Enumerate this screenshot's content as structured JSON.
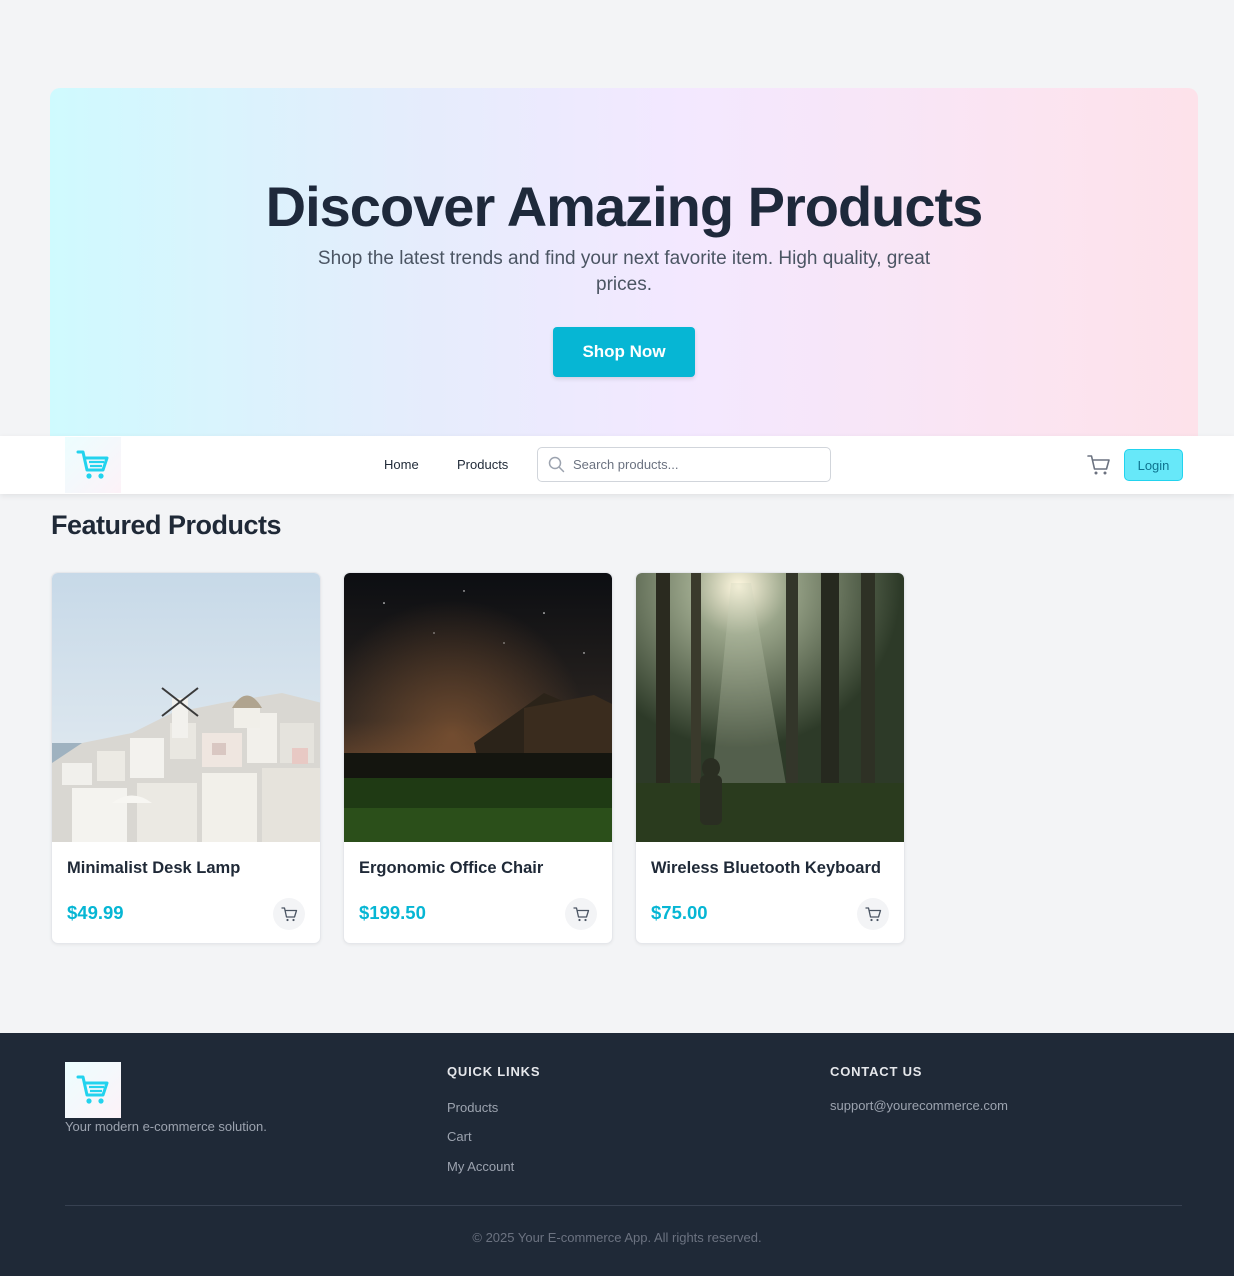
{
  "hero": {
    "title": "Discover Amazing Products",
    "subtitle": "Shop the latest trends and find your next favorite item. High quality, great prices.",
    "cta_label": "Shop Now"
  },
  "nav": {
    "home": "Home",
    "products": "Products",
    "search_placeholder": "Search products...",
    "login": "Login"
  },
  "featured": {
    "title": "Featured Products",
    "products": [
      {
        "name": "Minimalist Desk Lamp",
        "price": "$49.99"
      },
      {
        "name": "Ergonomic Office Chair",
        "price": "$199.50"
      },
      {
        "name": "Wireless Bluetooth Keyboard",
        "price": "$75.00"
      }
    ]
  },
  "footer": {
    "tagline": "Your modern e-commerce solution.",
    "quick_links_heading": "QUICK LINKS",
    "links": [
      "Products",
      "Cart",
      "My Account"
    ],
    "contact_heading": "CONTACT US",
    "email": "support@yourecommerce.com",
    "copyright": "© 2025 Your E-commerce App. All rights reserved."
  },
  "colors": {
    "accent": "#06b6d4",
    "footer_bg": "#1f2937",
    "page_bg": "#f3f4f6"
  },
  "icons": [
    "shopping-cart-logo-icon",
    "search-icon",
    "cart-icon",
    "add-to-cart-icon"
  ]
}
